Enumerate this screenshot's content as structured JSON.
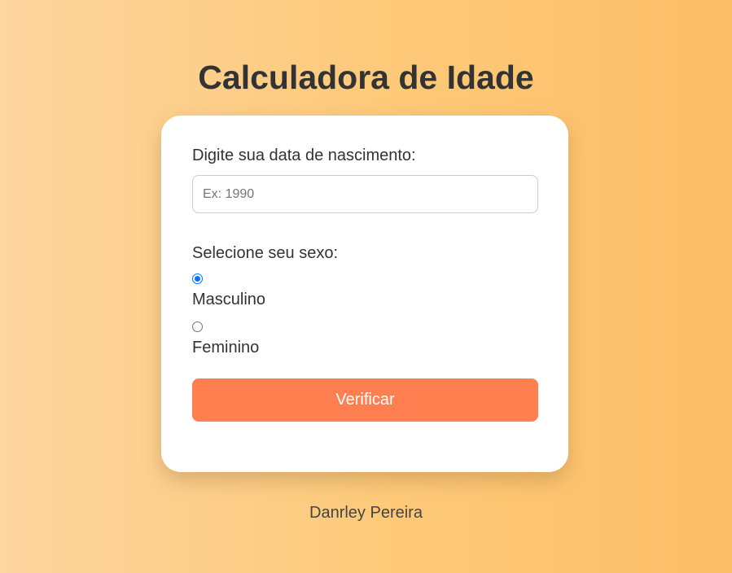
{
  "header": {
    "title": "Calculadora de Idade"
  },
  "form": {
    "birth_label": "Digite sua data de nascimento:",
    "birth_input": {
      "value": "",
      "placeholder": "Ex: 1990"
    },
    "sex_label": "Selecione seu sexo:",
    "sex_options": [
      {
        "label": "Masculino",
        "checked": true
      },
      {
        "label": "Feminino",
        "checked": false
      }
    ],
    "submit_label": "Verificar"
  },
  "footer": {
    "author": "Danrley Pereira"
  },
  "colors": {
    "button": "#ff7f50",
    "radio_accent": "#0075ff",
    "background_start": "#fdd59f",
    "background_end": "#fdbe68"
  },
  "icons": {
    "radio_checked": "radio-checked-icon",
    "radio_unchecked": "radio-unchecked-icon"
  }
}
